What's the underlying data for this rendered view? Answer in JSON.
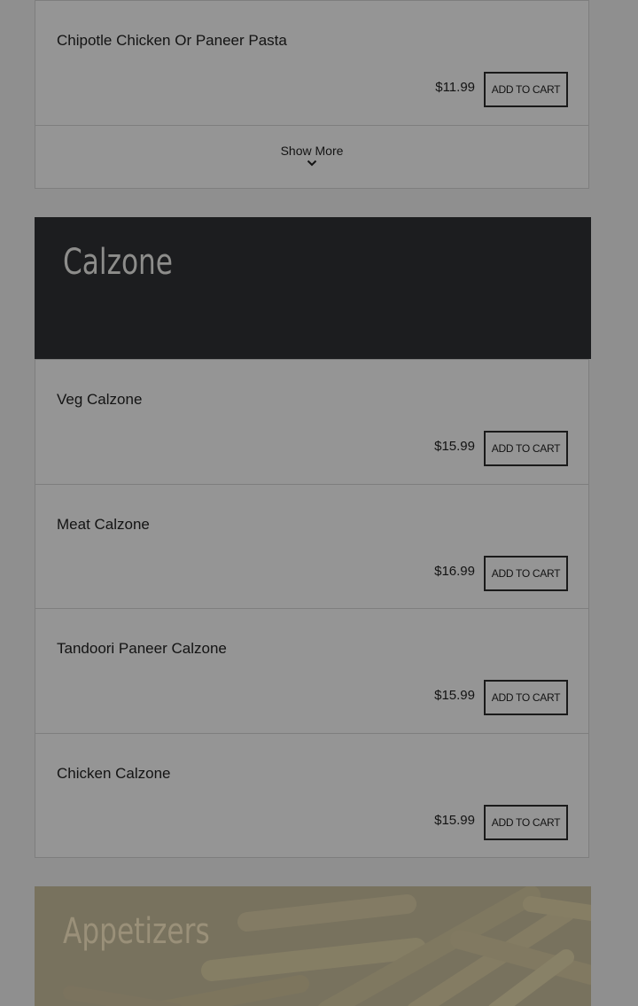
{
  "pasta_section": {
    "items": [
      {
        "name": "Chipotle Chicken Or Paneer Pasta",
        "price": "$11.99",
        "button": "ADD TO CART"
      }
    ],
    "show_more_label": "Show More"
  },
  "calzone_section": {
    "title": "Calzone",
    "items": [
      {
        "name": "Veg Calzone",
        "price": "$15.99",
        "button": "ADD TO CART"
      },
      {
        "name": "Meat Calzone",
        "price": "$16.99",
        "button": "ADD TO CART"
      },
      {
        "name": "Tandoori Paneer Calzone",
        "price": "$15.99",
        "button": "ADD TO CART"
      },
      {
        "name": "Chicken Calzone",
        "price": "$15.99",
        "button": "ADD TO CART"
      }
    ]
  },
  "appetizers_section": {
    "title": "Appetizers"
  },
  "icons": {
    "show_more": "chevron-down-icon"
  },
  "colors": {
    "page_bg": "#8f8f8f",
    "header_dark": "#1c1d1f",
    "text": "#131313"
  }
}
